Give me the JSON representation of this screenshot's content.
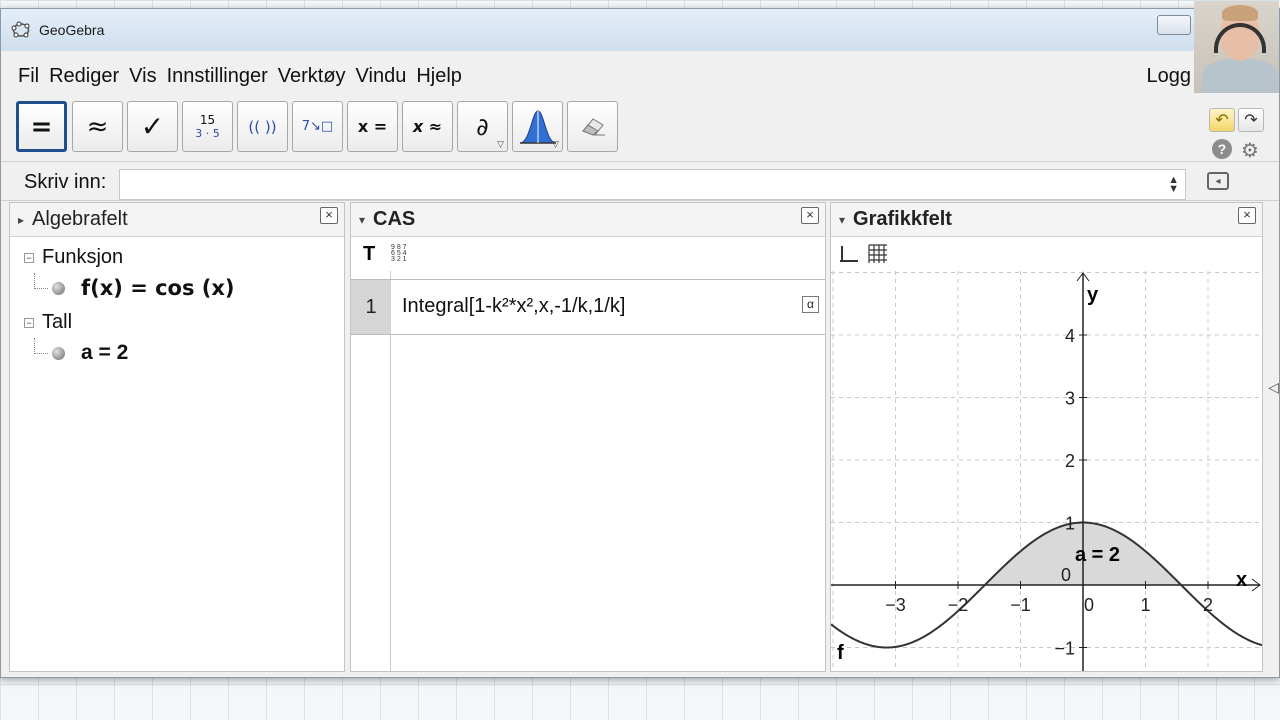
{
  "window": {
    "title": "GeoGebra"
  },
  "menu": {
    "items": [
      "Fil",
      "Rediger",
      "Vis",
      "Innstillinger",
      "Verktøy",
      "Vindu",
      "Hjelp"
    ],
    "login": "Logg"
  },
  "toolbar": {
    "tools": [
      {
        "name": "evaluate",
        "glyph": "="
      },
      {
        "name": "numeric",
        "glyph": "≈"
      },
      {
        "name": "keep-input",
        "glyph": "✓"
      },
      {
        "name": "factor",
        "glyph_top": "15",
        "glyph_bottom": "3 · 5"
      },
      {
        "name": "expand",
        "glyph": "(( ))"
      },
      {
        "name": "substitute",
        "glyph": "7↘□"
      },
      {
        "name": "solve",
        "glyph": "x ="
      },
      {
        "name": "solve-numerically",
        "glyph": "x ≈"
      },
      {
        "name": "derivative",
        "glyph": "∂"
      },
      {
        "name": "probability",
        "glyph": "distribution"
      },
      {
        "name": "delete",
        "glyph": "eraser"
      }
    ]
  },
  "input_bar": {
    "label": "Skriv inn:",
    "value": ""
  },
  "algebra": {
    "title": "Algebrafelt",
    "groups": [
      {
        "label": "Funksjon",
        "items": [
          "f(x)  =  cos (x)"
        ]
      },
      {
        "label": "Tall",
        "items": [
          "a = 2"
        ]
      }
    ]
  },
  "cas": {
    "title": "CAS",
    "rows": [
      {
        "number": "1",
        "expression": "Integral[1-k²*x²,x,-1/k,1/k]"
      }
    ]
  },
  "graphics": {
    "title": "Grafikkfelt",
    "x_axis_label": "x",
    "y_axis_label": "y",
    "origin_label": "0",
    "x_ticks": [
      "−3",
      "−2",
      "−1",
      "0",
      "1",
      "2"
    ],
    "y_ticks": [
      "4",
      "3",
      "2",
      "1",
      "−1"
    ],
    "function_label": "f",
    "area_label": "a = 2"
  },
  "colors": {
    "selected_tool_border": "#1f4f8c",
    "curve": "#333333",
    "shaded_area": "#d9d9d9"
  }
}
